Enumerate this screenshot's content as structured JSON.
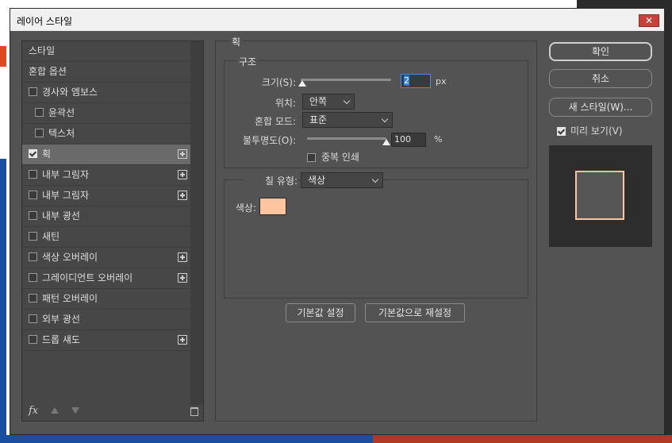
{
  "window": {
    "title": "레이어 스타일",
    "close_symbol": "✕"
  },
  "style_list": {
    "items": [
      {
        "label": "스타일",
        "checkbox": false,
        "checked": false,
        "plus": false,
        "selected": false,
        "indent": false
      },
      {
        "label": "혼합 옵션",
        "checkbox": false,
        "checked": false,
        "plus": false,
        "selected": false,
        "indent": false
      },
      {
        "label": "경사와 엠보스",
        "checkbox": true,
        "checked": false,
        "plus": false,
        "selected": false,
        "indent": false
      },
      {
        "label": "윤곽선",
        "checkbox": true,
        "checked": false,
        "plus": false,
        "selected": false,
        "indent": true
      },
      {
        "label": "텍스처",
        "checkbox": true,
        "checked": false,
        "plus": false,
        "selected": false,
        "indent": true
      },
      {
        "label": "획",
        "checkbox": true,
        "checked": true,
        "plus": true,
        "selected": true,
        "indent": false
      },
      {
        "label": "내부 그림자",
        "checkbox": true,
        "checked": false,
        "plus": true,
        "selected": false,
        "indent": false
      },
      {
        "label": "내부 그림자",
        "checkbox": true,
        "checked": false,
        "plus": true,
        "selected": false,
        "indent": false
      },
      {
        "label": "내부 광선",
        "checkbox": true,
        "checked": false,
        "plus": false,
        "selected": false,
        "indent": false
      },
      {
        "label": "새틴",
        "checkbox": true,
        "checked": false,
        "plus": false,
        "selected": false,
        "indent": false
      },
      {
        "label": "색상 오버레이",
        "checkbox": true,
        "checked": false,
        "plus": true,
        "selected": false,
        "indent": false
      },
      {
        "label": "그레이디언트 오버레이",
        "checkbox": true,
        "checked": false,
        "plus": true,
        "selected": false,
        "indent": false
      },
      {
        "label": "패턴 오버레이",
        "checkbox": true,
        "checked": false,
        "plus": false,
        "selected": false,
        "indent": false
      },
      {
        "label": "외부 광선",
        "checkbox": true,
        "checked": false,
        "plus": false,
        "selected": false,
        "indent": false
      },
      {
        "label": "드롭 섀도",
        "checkbox": true,
        "checked": false,
        "plus": true,
        "selected": false,
        "indent": false
      }
    ],
    "footer": {
      "fx_label": "fx"
    }
  },
  "stroke": {
    "section_title": "획",
    "structure_title": "구조",
    "size": {
      "label": "크기(S):",
      "value": "2",
      "unit": "px",
      "level": 0.02
    },
    "position": {
      "label": "위치:",
      "value": "안쪽"
    },
    "blend_mode": {
      "label": "혼합 모드:",
      "value": "표준"
    },
    "opacity": {
      "label": "불투명도(O):",
      "value": "100",
      "unit": "%",
      "level": 1.0
    },
    "overprint": {
      "label": "중복 인쇄",
      "checked": false
    },
    "fill_type": {
      "label": "칠 유형:",
      "value": "색상"
    },
    "color": {
      "label": "색상:",
      "hex": "#ffc4a0"
    },
    "buttons": {
      "make_default": "기본값 설정",
      "reset_default": "기본값으로 재설정"
    }
  },
  "actions": {
    "ok": "확인",
    "cancel": "취소",
    "new_style": "새 스타일(W)...",
    "preview_label": "미리 보기(V)",
    "preview_checked": true
  }
}
